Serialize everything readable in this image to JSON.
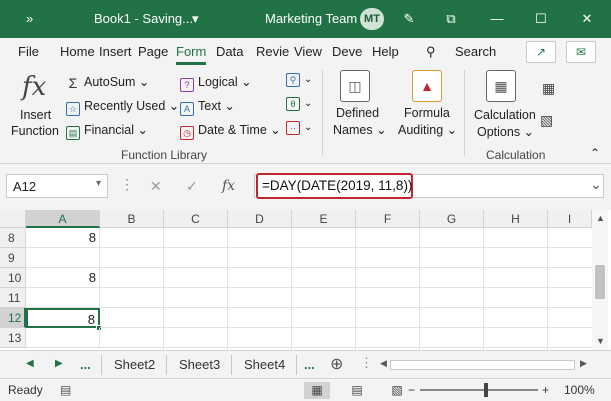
{
  "titlebar": {
    "qat_label": "»",
    "doc_title": "Book1 - Saving...",
    "doc_dropdown": "▾",
    "team": "Marketing Team",
    "avatar": "MT",
    "pen_icon": "✎",
    "restore_icon": "⧉",
    "minimize": "—",
    "maximize": "☐",
    "close": "✕"
  },
  "tabs": [
    "File",
    "Home",
    "Insert",
    "Page",
    "Form",
    "Data",
    "Revie",
    "View",
    "Deve",
    "Help"
  ],
  "search_label": "Search",
  "ribbon": {
    "insert_function": [
      "Insert",
      "Function"
    ],
    "fx": "fx",
    "col1": [
      {
        "icon": "Σ",
        "label": "AutoSum",
        "arrow": "⌄"
      },
      {
        "icon": "☆",
        "label": "Recently Used",
        "arrow": "⌄"
      },
      {
        "icon": "▤",
        "label": "Financial",
        "arrow": "⌄"
      }
    ],
    "col2": [
      {
        "icon": "?",
        "label": "Logical",
        "arrow": "⌄"
      },
      {
        "icon": "A",
        "label": "Text",
        "arrow": "⌄"
      },
      {
        "icon": "◷",
        "label": "Date & Time",
        "arrow": "⌄"
      }
    ],
    "defined_names": [
      "Defined",
      "Names ⌄"
    ],
    "formula_auditing": [
      "Formula",
      "Auditing ⌄"
    ],
    "calculation_options": [
      "Calculation",
      "Options ⌄"
    ],
    "group_function_library": "Function Library",
    "group_calculation": "Calculation",
    "collapse": "⌃"
  },
  "formula_bar": {
    "name_box": "A12",
    "cancel": "✕",
    "enter": "✓",
    "fx": "fx",
    "formula": "=DAY(DATE(2019, 11,8))",
    "expand": "⌄"
  },
  "grid": {
    "columns": [
      "A",
      "B",
      "C",
      "D",
      "E",
      "F",
      "G",
      "H",
      "I"
    ],
    "selected_column": "A",
    "rows": [
      {
        "num": "8",
        "a": "8"
      },
      {
        "num": "9",
        "a": ""
      },
      {
        "num": "10",
        "a": "8"
      },
      {
        "num": "11",
        "a": ""
      },
      {
        "num": "12",
        "a": "8",
        "selected": true
      },
      {
        "num": "13",
        "a": ""
      }
    ]
  },
  "sheets": {
    "prev": "◀",
    "next": "▶",
    "ellipsis": "...",
    "tabs": [
      "Sheet2",
      "Sheet3",
      "Sheet4"
    ],
    "more": "...",
    "add": "⊕"
  },
  "status": {
    "ready": "Ready",
    "zoom_minus": "−",
    "zoom_plus": "+",
    "zoom": "100%",
    "zoom_level": 0.5
  }
}
